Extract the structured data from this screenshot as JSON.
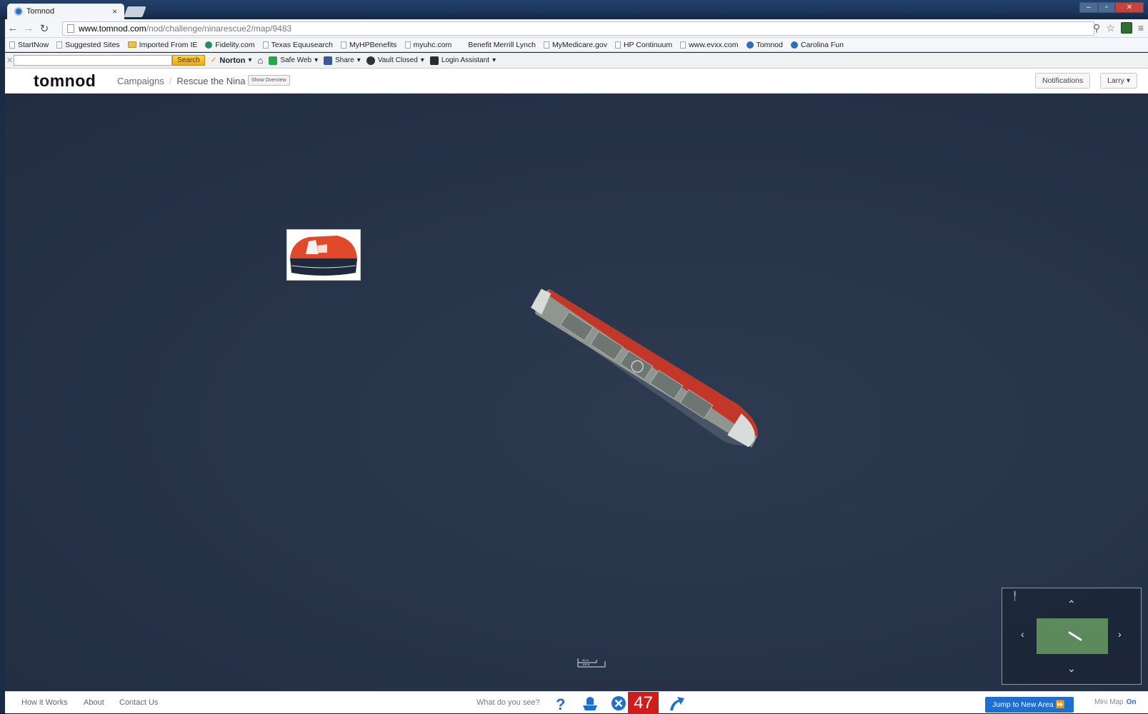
{
  "browser": {
    "tab_title": "Tomnod",
    "tab_close": "×",
    "url_host": "www.tomnod.com",
    "url_path": "/nod/challenge/ninarescue2/map/9483",
    "bookmarks": [
      "StartNow",
      "Suggested Sites",
      "Imported From IE",
      "Fidelity.com",
      "Texas Equusearch",
      "MyHPBenefits",
      "myuhc.com",
      "Benefit Merrill Lynch",
      "MyMedicare.gov",
      "HP Continuum",
      "www.evxx.com",
      "Tomnod",
      "Carolina Fun"
    ]
  },
  "norton": {
    "search_label": "Search",
    "brand": "Norton",
    "safe_web": "Safe Web",
    "share": "Share",
    "vault": "Vault Closed",
    "login_assistant": "Login Assistant"
  },
  "site": {
    "logo": "tomnod",
    "crumbs": [
      "Campaigns",
      "Rescue the Nina"
    ],
    "show_overview": "Show Overview",
    "notifications": "Notifications",
    "user": "Larry"
  },
  "map": {
    "scale_top": "20 m",
    "scale_bottom": "100 ft"
  },
  "footer": {
    "links": [
      "How it Works",
      "About",
      "Contact Us"
    ],
    "prompt": "What do you see?",
    "count": "47",
    "jump": "Jump to New Area",
    "minimap_label": "Mini Map",
    "minimap_state": "On"
  },
  "colors": {
    "accent": "#1f6fd0",
    "count_bg": "#d01c1c",
    "ocean": "#28344a"
  }
}
